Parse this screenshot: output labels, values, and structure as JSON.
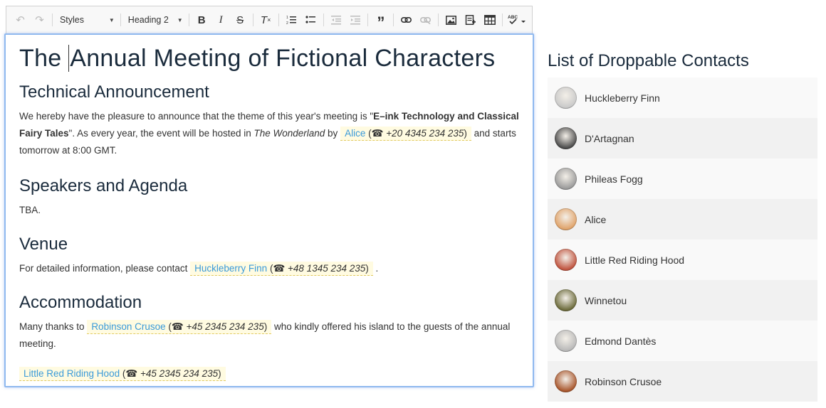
{
  "toolbar": {
    "styles_label": "Styles",
    "format_label": "Heading 2"
  },
  "editor": {
    "title": "The Annual Meeting of Fictional Characters",
    "sections": {
      "tech_heading": "Technical Announcement",
      "tech_p1_before": "We hereby have the pleasure to announce that the theme of this year's meeting is \"",
      "tech_p1_bold": "E–ink Technology and Classical Fairy Tales",
      "tech_p1_mid": "\". As every year, the event will be hosted in ",
      "tech_p1_italic": "The Wonderland",
      "tech_p1_by": " by ",
      "tech_p1_after": " and starts tomorrow at 8:00 GMT.",
      "speakers_heading": "Speakers and Agenda",
      "speakers_text": "TBA.",
      "venue_heading": "Venue",
      "venue_before": "For detailed information, please contact ",
      "venue_after": " .",
      "accom_heading": "Accommodation",
      "accom_before": "Many thanks to ",
      "accom_after": " who kindly offered his island to the guests of the annual meeting."
    },
    "inline_contacts": {
      "alice": {
        "name": "Alice",
        "phone": "+20 4345 234 235"
      },
      "finn": {
        "name": "Huckleberry Finn",
        "phone": "+48 1345 234 235"
      },
      "crusoe": {
        "name": "Robinson Crusoe",
        "phone": "+45 2345 234 235"
      },
      "red": {
        "name": "Little Red Riding Hood",
        "phone": "+45 2345 234 235"
      }
    },
    "phone_glyph": "☎"
  },
  "contacts_panel": {
    "title": "List of Droppable Contacts",
    "items": [
      {
        "name": "Huckleberry Finn",
        "avatar_color": "#c9c9c9"
      },
      {
        "name": "D'Artagnan",
        "avatar_color": "#4a4a4a"
      },
      {
        "name": "Phileas Fogg",
        "avatar_color": "#9a9a9a"
      },
      {
        "name": "Alice",
        "avatar_color": "#e0a36a"
      },
      {
        "name": "Little Red Riding Hood",
        "avatar_color": "#c0533e"
      },
      {
        "name": "Winnetou",
        "avatar_color": "#6b6a3a"
      },
      {
        "name": "Edmond Dantès",
        "avatar_color": "#b8b8b8"
      },
      {
        "name": "Robinson Crusoe",
        "avatar_color": "#a8552b"
      }
    ]
  }
}
